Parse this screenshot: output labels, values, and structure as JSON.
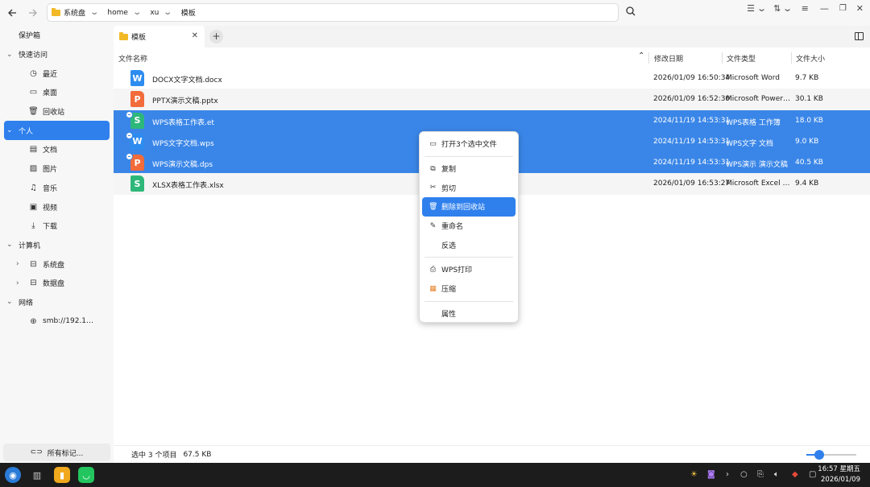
{
  "nav": {
    "back_icon": "arrow-left-icon",
    "forward_icon": "arrow-right-icon"
  },
  "breadcrumb": [
    {
      "label": "系统盘"
    },
    {
      "label": "home"
    },
    {
      "label": "xu"
    },
    {
      "label": "模板"
    }
  ],
  "sidebar": {
    "vault": "保护箱",
    "quick_access": "快速访问",
    "recent": "最近",
    "desktop": "桌面",
    "trash": "回收站",
    "personal": "个人",
    "documents": "文档",
    "pictures": "图片",
    "music": "音乐",
    "videos": "视频",
    "downloads": "下载",
    "computer": "计算机",
    "system_disk": "系统盘",
    "data_disk": "数据盘",
    "network": "网络",
    "smb": "smb://192.1…",
    "all_tags": "所有标记..."
  },
  "tab": {
    "label": "模板",
    "add": "+"
  },
  "columns": {
    "name": "文件名称",
    "date": "修改日期",
    "type": "文件类型",
    "size": "文件大小"
  },
  "files": [
    {
      "name": "DOCX文字文档.docx",
      "date": "2026/01/09 16:50:34",
      "type": "Microsoft Word",
      "size": "9.7 KB",
      "icon": "W",
      "kind": "w",
      "selected": false
    },
    {
      "name": "PPTX演示文稿.pptx",
      "date": "2026/01/09 16:52:30",
      "type": "Microsoft Power…",
      "size": "30.1 KB",
      "icon": "P",
      "kind": "p",
      "selected": false
    },
    {
      "name": "WPS表格工作表.et",
      "date": "2024/11/19 14:53:31",
      "type": "WPS表格 工作簿",
      "size": "18.0 KB",
      "icon": "S",
      "kind": "s",
      "selected": true
    },
    {
      "name": "WPS文字文档.wps",
      "date": "2024/11/19 14:53:31",
      "type": "WPS文字 文档",
      "size": "9.0 KB",
      "icon": "W",
      "kind": "w",
      "selected": true
    },
    {
      "name": "WPS演示文稿.dps",
      "date": "2024/11/19 14:53:31",
      "type": "WPS演示 演示文稿",
      "size": "40.5 KB",
      "icon": "P",
      "kind": "p",
      "selected": true
    },
    {
      "name": "XLSX表格工作表.xlsx",
      "date": "2026/01/09 16:53:27",
      "type": "Microsoft Excel …",
      "size": "9.4 KB",
      "icon": "S",
      "kind": "s",
      "selected": false
    }
  ],
  "context_menu": {
    "open": "打开3个选中文件",
    "copy": "复制",
    "cut": "剪切",
    "delete": "删除到回收站",
    "rename": "重命名",
    "invert": "反选",
    "wps_print": "WPS打印",
    "compress": "压缩",
    "properties": "属性"
  },
  "status": {
    "selected": "选中 3 个项目",
    "size": "67.5 KB",
    "zoom_level": 0.25
  },
  "clock": {
    "time": "16:57 星期五",
    "date": "2026/01/09"
  },
  "colors": {
    "accent": "#2f80ed",
    "selection": "#3a86e8"
  }
}
